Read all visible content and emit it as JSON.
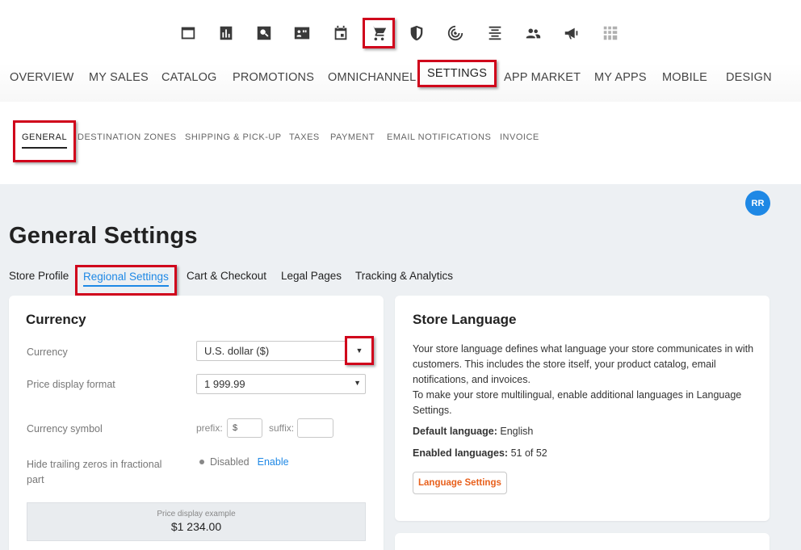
{
  "icons": [
    {
      "name": "dashboard-icon",
      "active": false
    },
    {
      "name": "reports-icon",
      "active": false
    },
    {
      "name": "search-icon",
      "active": false
    },
    {
      "name": "contacts-icon",
      "active": false
    },
    {
      "name": "calendar-icon",
      "active": false
    },
    {
      "name": "cart-icon",
      "active": true
    },
    {
      "name": "shield-icon",
      "active": false
    },
    {
      "name": "radar-icon",
      "active": false
    },
    {
      "name": "align-icon",
      "active": false
    },
    {
      "name": "users-icon",
      "active": false
    },
    {
      "name": "megaphone-icon",
      "active": false
    },
    {
      "name": "grid-icon",
      "active": false
    }
  ],
  "main_nav": {
    "overview": "OVERVIEW",
    "my_sales": "MY SALES",
    "catalog": "CATALOG",
    "promotions": "PROMOTIONS",
    "omnichannel": "OMNICHANNEL",
    "settings": "SETTINGS",
    "app_market": "APP MARKET",
    "my_apps": "MY APPS",
    "mobile": "MOBILE",
    "design": "DESIGN"
  },
  "sub_nav": {
    "general": "GENERAL",
    "destination_zones": "DESTINATION ZONES",
    "shipping": "SHIPPING & PICK-UP",
    "taxes": "TAXES",
    "payment": "PAYMENT",
    "email_notifications": "EMAIL NOTIFICATIONS",
    "invoice": "INVOICE"
  },
  "avatar": "RR",
  "page_title": "General Settings",
  "tabs": {
    "store_profile": "Store Profile",
    "regional_settings": "Regional Settings",
    "cart_checkout": "Cart & Checkout",
    "legal_pages": "Legal Pages",
    "tracking": "Tracking & Analytics"
  },
  "currency": {
    "title": "Currency",
    "currency_label": "Currency",
    "currency_value": "U.S. dollar ($)",
    "format_label": "Price display format",
    "format_value": "1 999.99",
    "symbol_label": "Currency symbol",
    "prefix_label": "prefix:",
    "prefix_value": "$",
    "suffix_label": "suffix:",
    "suffix_value": "",
    "zeros_label": "Hide trailing zeros in fractional part",
    "zeros_status": "Disabled",
    "zeros_enable": "Enable",
    "example_caption": "Price display example",
    "example_value": "$1 234.00"
  },
  "language": {
    "title": "Store Language",
    "description_1": "Your store language defines what language your store communicates in with customers. This includes the store itself, your product catalog, email notifications, and invoices.",
    "description_2": "To make your store multilingual, enable additional languages in Language Settings.",
    "default_label": "Default language:",
    "default_value": "English",
    "enabled_label": "Enabled languages:",
    "enabled_value": "51 of 52",
    "button": "Language Settings"
  }
}
